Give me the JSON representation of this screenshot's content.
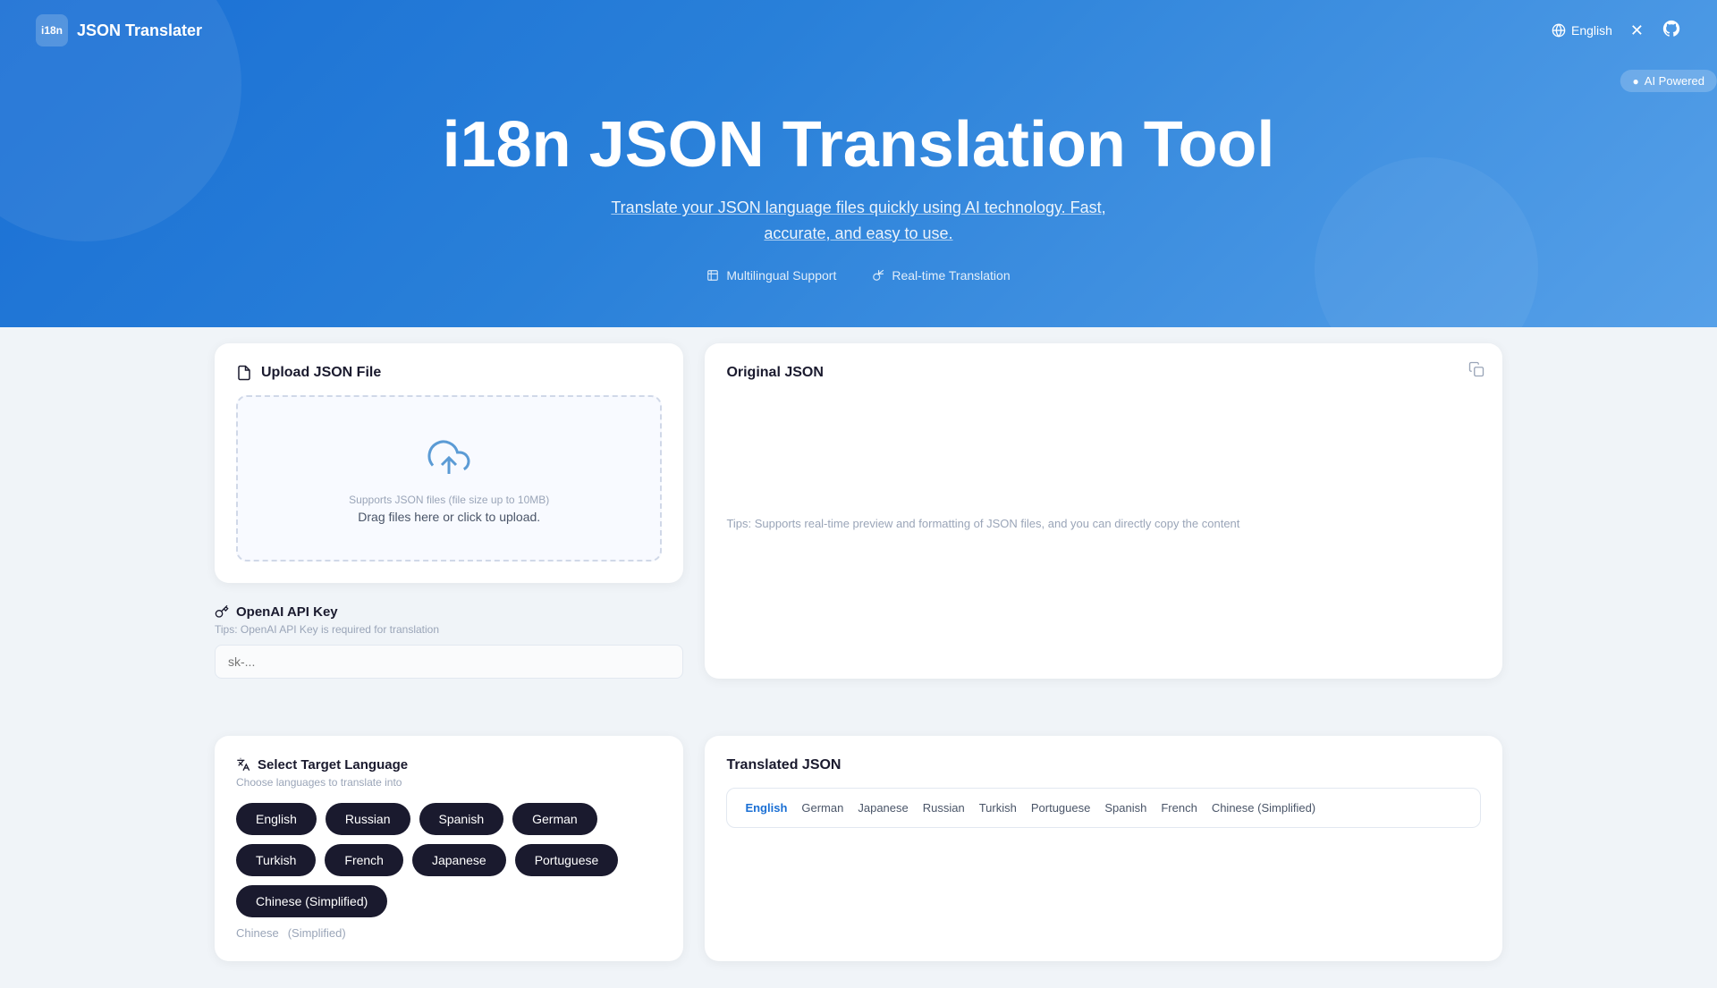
{
  "topbar": {
    "logo_icon": "i18n",
    "logo_text": "JSON Translater",
    "lang_label": "English",
    "close_icon": "✕",
    "github_icon": "github"
  },
  "hero": {
    "ai_badge": "AI Powered",
    "title": "i18n JSON Translation Tool",
    "subtitle_line1": "Translate your JSON language files quickly using AI technology. Fast,",
    "subtitle_line2": "accurate, and easy to use.",
    "feature1": "Multilingual Support",
    "feature2": "Real-time Translation"
  },
  "upload_card": {
    "title": "Upload JSON File",
    "hint": "Supports JSON files (file size up to 10MB)",
    "drag_text": "Drag files here or click to upload."
  },
  "openai": {
    "title": "OpenAI API Key",
    "tip": "Tips: OpenAI API Key is required for translation",
    "placeholder": "sk-..."
  },
  "original_json": {
    "title": "Original JSON",
    "tips": "Tips: Supports real-time preview and formatting of JSON files, and you can directly copy the content"
  },
  "target_lang": {
    "title": "Select Target Language",
    "subtitle": "Choose languages to translate into",
    "languages": [
      "English",
      "Russian",
      "Spanish",
      "German",
      "Turkish",
      "French",
      "Japanese",
      "Portuguese",
      "Chinese (Simplified)"
    ]
  },
  "translated_json": {
    "title": "Translated JSON",
    "tabs": [
      "English",
      "German",
      "Japanese",
      "Russian",
      "Turkish",
      "Portuguese",
      "Spanish",
      "French",
      "Chinese (Simplified)"
    ]
  },
  "more_langs": {
    "label1": "Chinese",
    "label2": "(Simplified)"
  }
}
